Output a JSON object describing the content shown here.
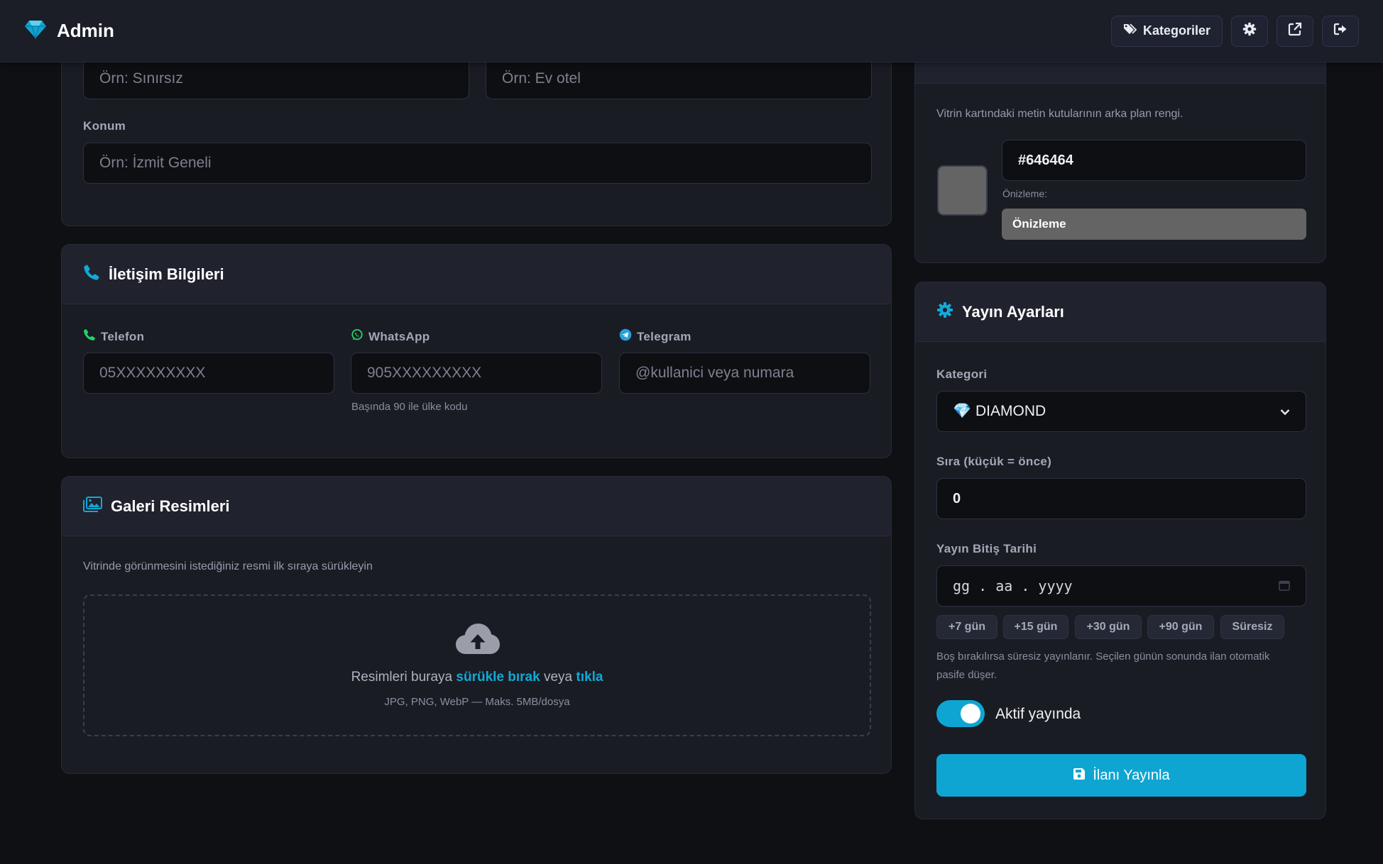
{
  "colors": {
    "accent": "#0ea5d3",
    "background": "#0f1014",
    "card": "#1a1c24",
    "whatsapp": "#25d366",
    "preview_swatch": "#646464"
  },
  "navbar": {
    "brand_icon": "diamond-icon",
    "brand": "Admin",
    "categories_label": "Kategoriler",
    "categories_icon": "tags-icon",
    "settings_icon": "gear-icon",
    "external_icon": "external-link-icon",
    "logout_icon": "logout-icon"
  },
  "location_card": {
    "input_left_placeholder": "Örn: Sınırsız",
    "input_right_placeholder": "Örn: Ev otel",
    "location_label": "Konum",
    "location_placeholder": "Örn: İzmit Geneli"
  },
  "contact_card": {
    "title": "İletişim Bilgileri",
    "title_icon": "phone-icon",
    "phone_label": "Telefon",
    "phone_placeholder": "05XXXXXXXXX",
    "whatsapp_label": "WhatsApp",
    "whatsapp_placeholder": "905XXXXXXXXX",
    "whatsapp_hint": "Başında 90 ile ülke kodu",
    "telegram_label": "Telegram",
    "telegram_placeholder": "@kullanici veya numara"
  },
  "gallery_card": {
    "title": "Galeri Resimleri",
    "title_icon": "images-icon",
    "description": "Vitrinde görünmesini istediğiniz resmi ilk sıraya sürükleyin",
    "upload_icon": "cloud-upload-icon",
    "drop_text_prefix": "Resimleri buraya ",
    "drop_text_link1": "sürükle bırak",
    "drop_text_middle": " veya ",
    "drop_text_link2": "tıkla",
    "drop_formats": "JPG, PNG, WebP — Maks. 5MB/dosya"
  },
  "color_card": {
    "description": "Vitrin kartındaki metin kutularının arka plan rengi.",
    "color_value": "#646464",
    "preview_label": "Önizleme:",
    "preview_box_text": "Önizleme"
  },
  "publish_card": {
    "title": "Yayın Ayarları",
    "title_icon": "gear-icon",
    "category_label": "Kategori",
    "category_value": "💎 DIAMOND",
    "order_label": "Sıra (küçük = önce)",
    "order_value": "0",
    "end_date_label": "Yayın Bitiş Tarihi",
    "end_date_placeholder": "gg . aa . yyyy",
    "quick_buttons": [
      "+7 gün",
      "+15 gün",
      "+30 gün",
      "+90 gün",
      "Süresiz"
    ],
    "end_date_hint_line1": "Boş bırakılırsa süresiz yayınlanır. Seçilen günün sonunda ilan otomatik",
    "end_date_hint_line2": "pasife düşer.",
    "active_toggle_on": true,
    "active_label": "Aktif yayında",
    "submit_label": "İlanı Yayınla",
    "submit_icon": "save-icon"
  }
}
